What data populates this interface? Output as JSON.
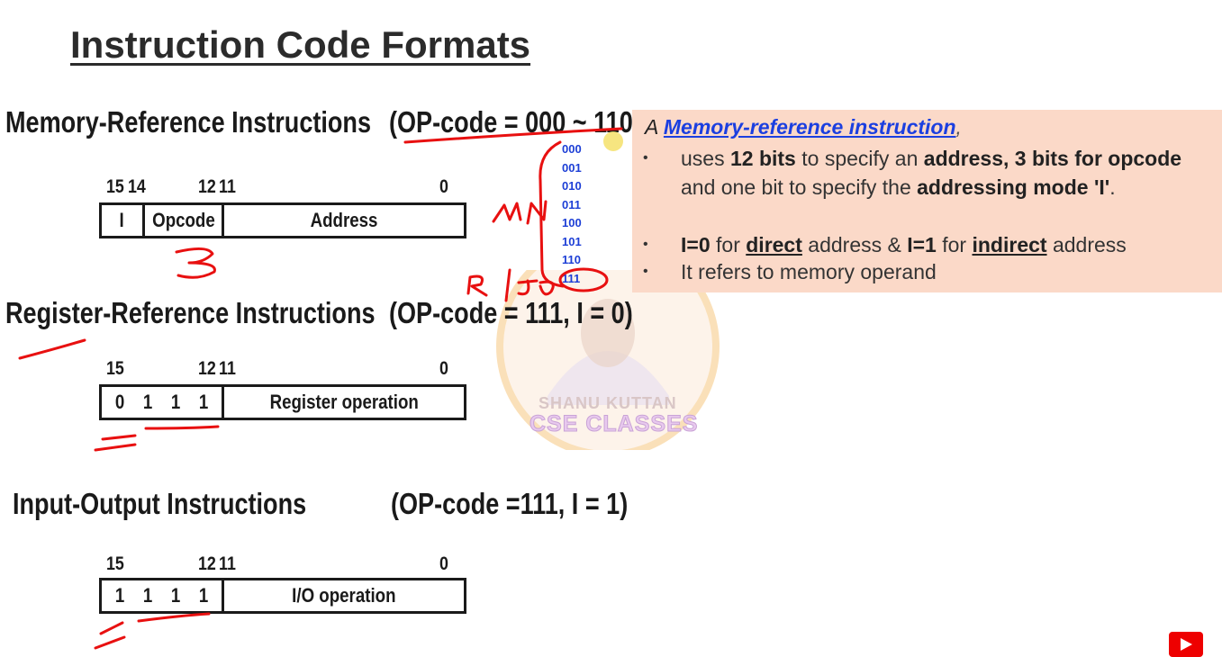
{
  "title": "Instruction Code Formats",
  "sections": [
    {
      "name": "Memory-Reference Instructions",
      "opcode": "(OP-code = 000 ~ 110)",
      "bit_labels": [
        "15",
        "14",
        "12",
        "11",
        "0"
      ],
      "fields": [
        "I",
        "Opcode",
        "Address"
      ]
    },
    {
      "name": "Register-Reference Instructions",
      "opcode": "(OP-code = 111, I = 0)",
      "bit_labels": [
        "15",
        "12",
        "11",
        "0"
      ],
      "fields": [
        "0",
        "1",
        "1",
        "1",
        "Register operation"
      ]
    },
    {
      "name": "Input-Output Instructions",
      "opcode": "(OP-code =111, I = 1)",
      "bit_labels": [
        "15",
        "12",
        "11",
        "0"
      ],
      "fields": [
        "1",
        "1",
        "1",
        "1",
        "I/O operation"
      ]
    }
  ],
  "opcode_list": [
    "000",
    "001",
    "010",
    "011",
    "100",
    "101",
    "110",
    "111"
  ],
  "panel": {
    "intro": "A",
    "link": "Memory-reference instruction",
    "comma": ",",
    "bullet1": {
      "t1": "uses ",
      "b1": "12 bits",
      "t2": " to specify an ",
      "b2": "address, 3 bits for opcode",
      "t3": " and one bit to specify the ",
      "b3": "addressing mode 'I'",
      "t4": "."
    },
    "bullet2": {
      "b1": "I=0",
      "t1": " for ",
      "u1": "direct",
      "t2": " address & ",
      "b2": "I=1",
      "t3": " for ",
      "u2": "indirect",
      "t4": " address"
    },
    "bullet3": "It refers to memory operand"
  },
  "annotations": {
    "mri": "MRI",
    "rio": "R|IO",
    "three": "3"
  },
  "watermark": {
    "line1": "SHANU KUTTAN",
    "line2": "CSE CLASSES"
  },
  "colors": {
    "panel_bg": "#fbd9c8",
    "link": "#1b3fe0",
    "opcode_list": "#1d3fd6",
    "ink": "#e81010"
  }
}
